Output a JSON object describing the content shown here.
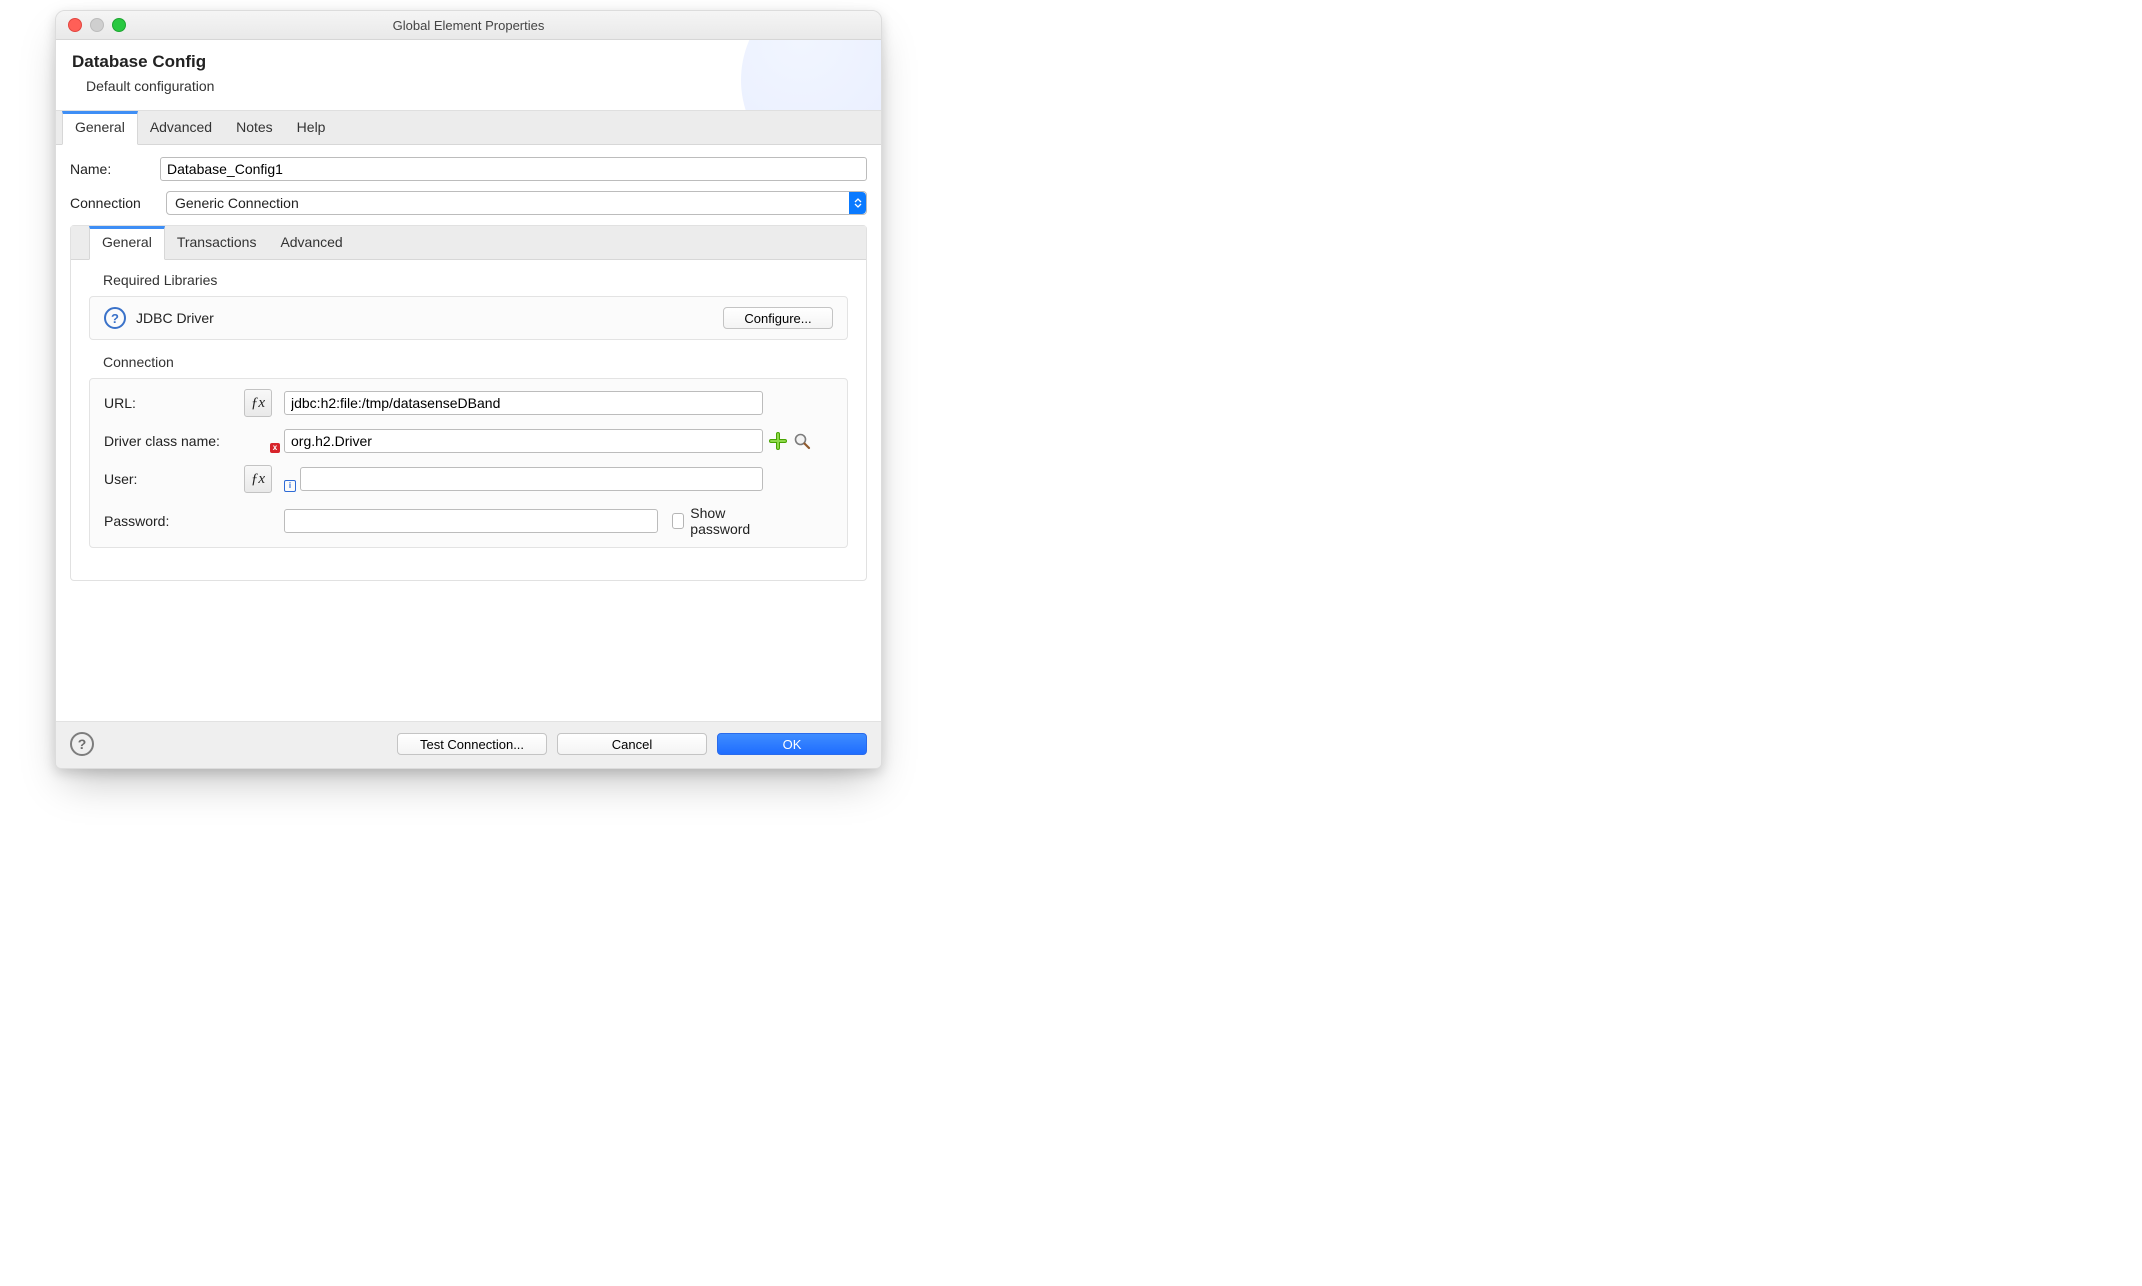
{
  "window": {
    "title": "Global Element Properties"
  },
  "header": {
    "title": "Database Config",
    "subtitle": "Default configuration"
  },
  "tabs": {
    "general": "General",
    "advanced": "Advanced",
    "notes": "Notes",
    "help": "Help"
  },
  "fields": {
    "name_label": "Name:",
    "name_value": "Database_Config1",
    "connection_label": "Connection",
    "connection_value": "Generic Connection"
  },
  "inner_tabs": {
    "general": "General",
    "transactions": "Transactions",
    "advanced": "Advanced"
  },
  "required_libraries": {
    "title": "Required Libraries",
    "jdbc_label": "JDBC Driver",
    "configure": "Configure..."
  },
  "connection_section": {
    "title": "Connection",
    "url_label": "URL:",
    "url_value": "jdbc:h2:file:/tmp/datasenseDBand",
    "driver_label": "Driver class name:",
    "driver_value": "org.h2.Driver",
    "user_label": "User:",
    "user_value": "",
    "password_label": "Password:",
    "password_value": "",
    "show_password": "Show password"
  },
  "footer": {
    "test": "Test Connection...",
    "cancel": "Cancel",
    "ok": "OK"
  }
}
